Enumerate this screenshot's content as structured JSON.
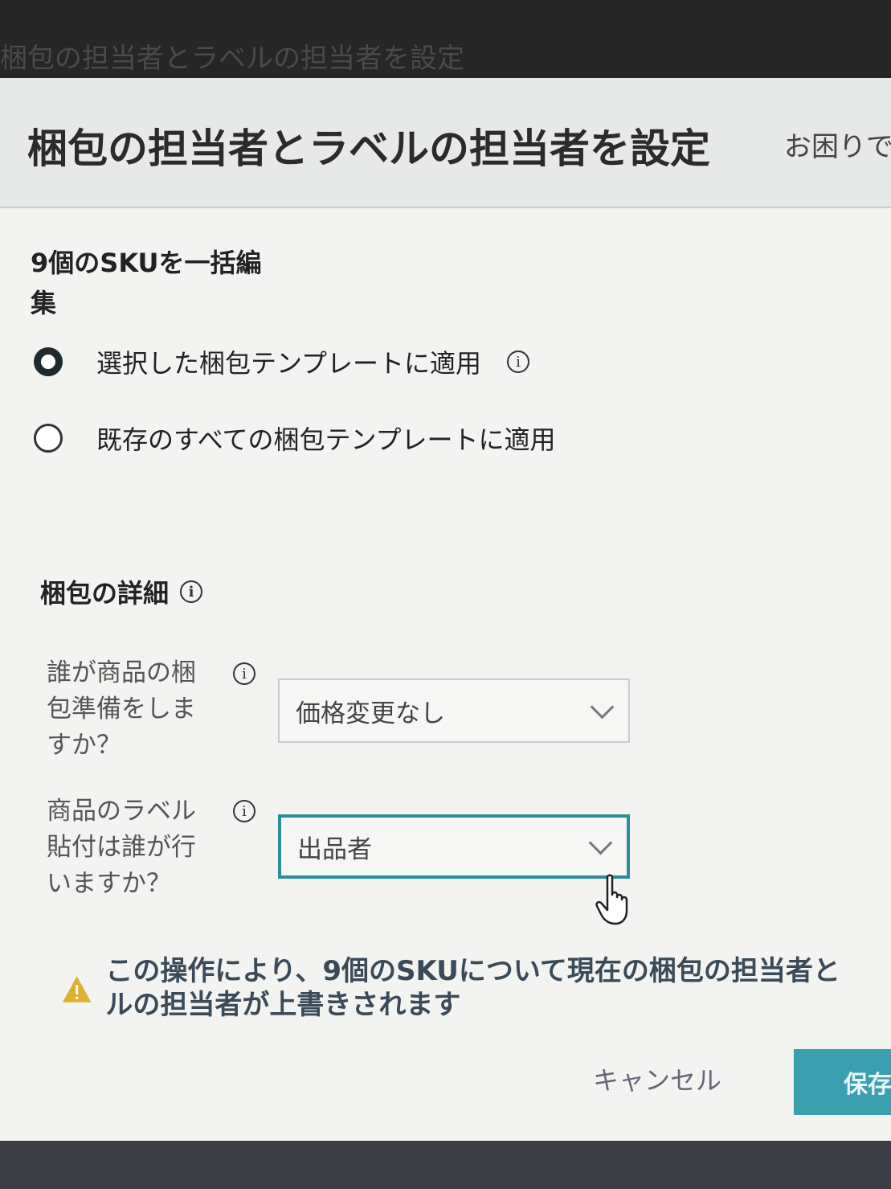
{
  "backdrop": {
    "title": "梱包の担当者とラベルの担当者を設定"
  },
  "modal": {
    "title": "梱包の担当者とラベルの担当者を設定",
    "help_link": "お困りで"
  },
  "bulk_edit": {
    "label": "9個のSKUを一括編集"
  },
  "apply_options": [
    {
      "label": "選択した梱包テンプレートに適用",
      "checked": true,
      "has_info": true
    },
    {
      "label": "既存のすべての梱包テンプレートに適用",
      "checked": false,
      "has_info": false
    }
  ],
  "packaging_details": {
    "title": "梱包の詳細",
    "prep_field": {
      "label": "誰が商品の梱包準備をしますか？",
      "value": "価格変更なし"
    },
    "label_field": {
      "label": "商品のラベル貼付は誰が行いますか？",
      "value": "出品者"
    }
  },
  "warning": {
    "line1": "この操作により、9個のSKUについて現在の梱包の担当者と",
    "line2": "ルの担当者が上書きされます"
  },
  "footer": {
    "cancel_label": "キャンセル",
    "save_label": "保存"
  },
  "colors": {
    "accent": "#3aa0b0",
    "focus_border": "#2a8f99",
    "warning_icon": "#e0b030"
  },
  "icons": {
    "info": "info-icon",
    "warning": "warning-icon",
    "chevron": "chevron-down-icon",
    "cursor": "hand-pointer-icon"
  }
}
